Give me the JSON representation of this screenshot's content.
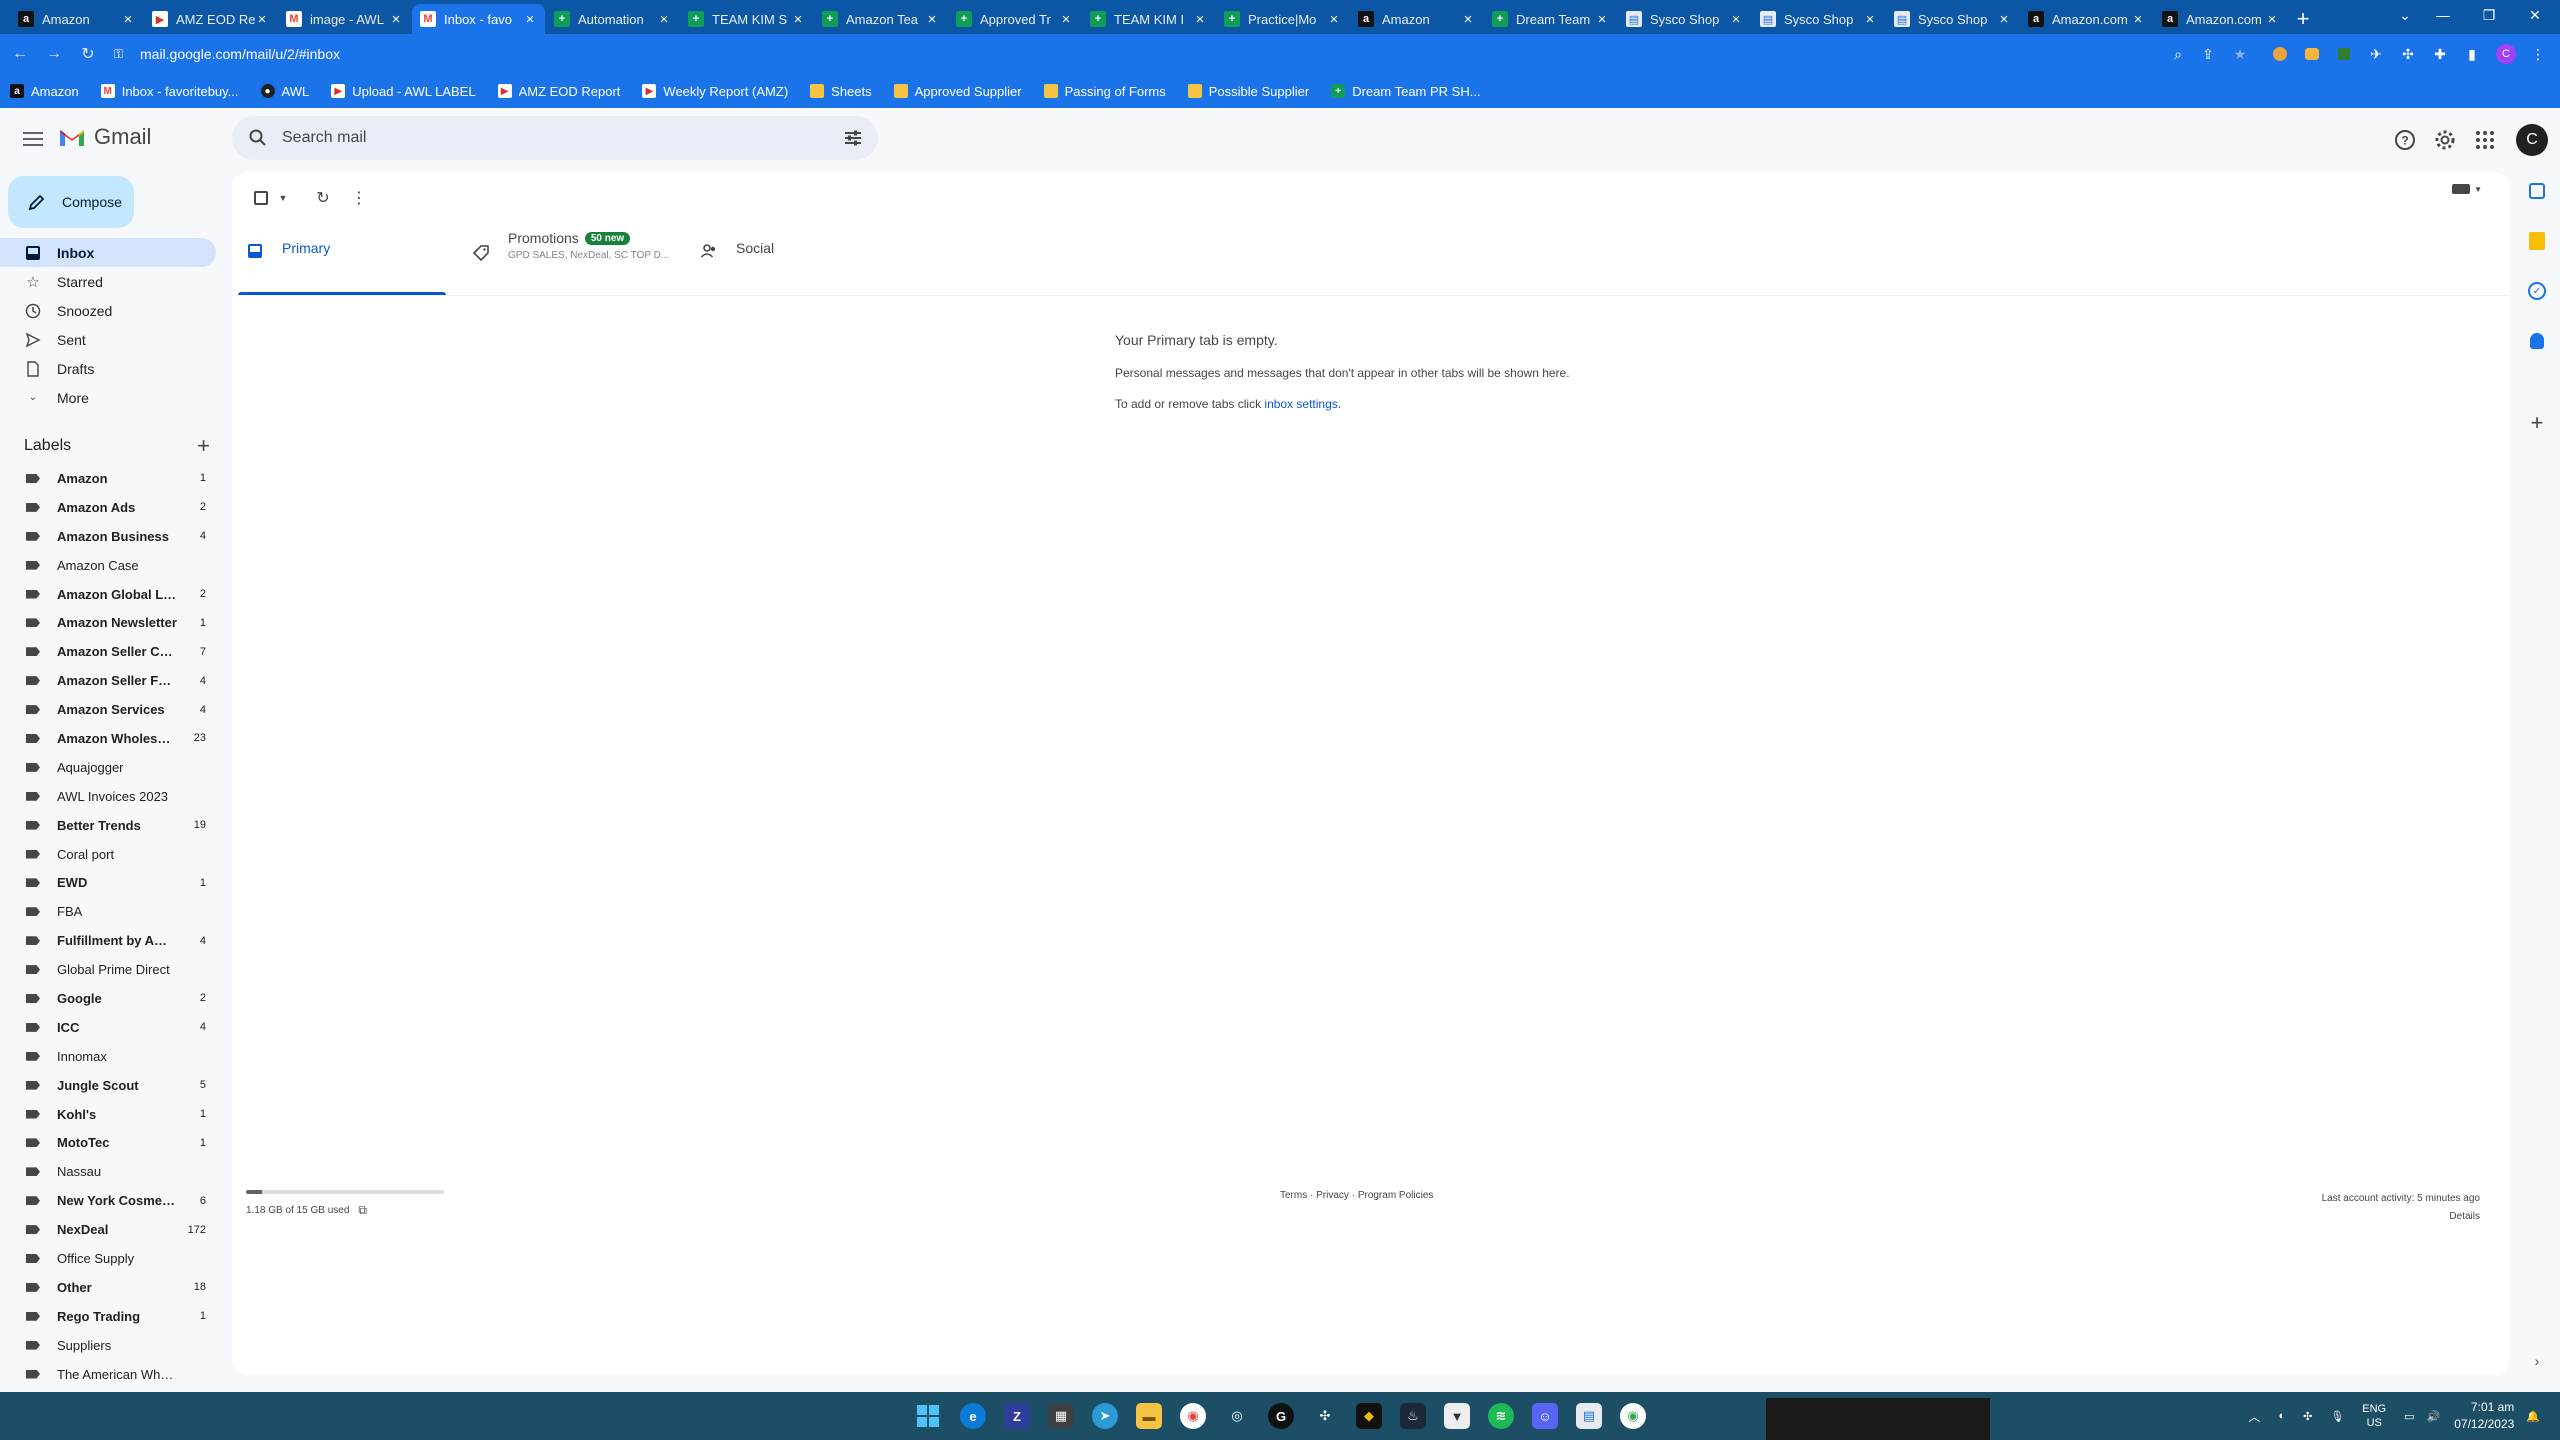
{
  "browser": {
    "tabs": [
      {
        "title": "Amazon",
        "icon": "amazon"
      },
      {
        "title": "AMZ EOD Re",
        "icon": "awl"
      },
      {
        "title": "image - AWL",
        "icon": "gmail"
      },
      {
        "title": "Inbox - favo",
        "icon": "gmail"
      },
      {
        "title": "Automation",
        "icon": "sheets"
      },
      {
        "title": "TEAM KIM S",
        "icon": "sheets"
      },
      {
        "title": "Amazon Tea",
        "icon": "sheets"
      },
      {
        "title": "Approved Tr",
        "icon": "sheets"
      },
      {
        "title": "TEAM KIM I",
        "icon": "sheets"
      },
      {
        "title": "Practice|Mo",
        "icon": "sheets"
      },
      {
        "title": "Amazon",
        "icon": "amazon"
      },
      {
        "title": "Dream Team",
        "icon": "sheets"
      },
      {
        "title": "Sysco Shop",
        "icon": "sysco"
      },
      {
        "title": "Sysco Shop",
        "icon": "sysco"
      },
      {
        "title": "Sysco Shop",
        "icon": "sysco"
      },
      {
        "title": "Amazon.com",
        "icon": "amazon"
      },
      {
        "title": "Amazon.com",
        "icon": "amazon"
      }
    ],
    "active_tab": 3,
    "url": "mail.google.com/mail/u/2/#inbox",
    "profile_initial": "C",
    "bookmarks": [
      {
        "label": "Amazon",
        "icon": "amazon"
      },
      {
        "label": "Inbox - favoritebuy...",
        "icon": "gmail"
      },
      {
        "label": "AWL",
        "icon": "dark"
      },
      {
        "label": "Upload - AWL LABEL",
        "icon": "awl"
      },
      {
        "label": "AMZ EOD Report",
        "icon": "awl"
      },
      {
        "label": "Weekly Report (AMZ)",
        "icon": "awl"
      },
      {
        "label": "Sheets",
        "icon": "folder"
      },
      {
        "label": "Approved Supplier",
        "icon": "folder"
      },
      {
        "label": "Passing of Forms",
        "icon": "folder"
      },
      {
        "label": "Possible Supplier",
        "icon": "folder"
      },
      {
        "label": "Dream Team PR SH...",
        "icon": "sheets"
      }
    ]
  },
  "gmail": {
    "brand": "Gmail",
    "search_placeholder": "Search mail",
    "avatar_initial": "C",
    "compose_label": "Compose",
    "nav": [
      {
        "label": "Inbox",
        "icon": "inbox-icon",
        "active": true
      },
      {
        "label": "Starred",
        "icon": "star-icon"
      },
      {
        "label": "Snoozed",
        "icon": "clock-icon"
      },
      {
        "label": "Sent",
        "icon": "send-icon"
      },
      {
        "label": "Drafts",
        "icon": "draft-icon"
      },
      {
        "label": "More",
        "icon": "chevron-down-icon"
      }
    ],
    "labels_title": "Labels",
    "labels": [
      {
        "name": "Amazon",
        "count": "1",
        "bold": true
      },
      {
        "name": "Amazon Ads",
        "count": "2",
        "bold": true
      },
      {
        "name": "Amazon Business",
        "count": "4",
        "bold": true
      },
      {
        "name": "Amazon Case",
        "count": "",
        "bold": false
      },
      {
        "name": "Amazon Global Lo...",
        "count": "2",
        "bold": true
      },
      {
        "name": "Amazon Newsletter",
        "count": "1",
        "bold": true
      },
      {
        "name": "Amazon Seller Cen...",
        "count": "7",
        "bold": true
      },
      {
        "name": "Amazon Seller For...",
        "count": "4",
        "bold": true
      },
      {
        "name": "Amazon Services",
        "count": "4",
        "bold": true
      },
      {
        "name": "Amazon Wholesal...",
        "count": "23",
        "bold": true
      },
      {
        "name": "Aquajogger",
        "count": "",
        "bold": false
      },
      {
        "name": "AWL Invoices 2023",
        "count": "",
        "bold": false
      },
      {
        "name": "Better Trends",
        "count": "19",
        "bold": true
      },
      {
        "name": "Coral port",
        "count": "",
        "bold": false
      },
      {
        "name": "EWD",
        "count": "1",
        "bold": true
      },
      {
        "name": "FBA",
        "count": "",
        "bold": false
      },
      {
        "name": "Fulfillment by Ama...",
        "count": "4",
        "bold": true
      },
      {
        "name": "Global Prime Direct",
        "count": "",
        "bold": false
      },
      {
        "name": "Google",
        "count": "2",
        "bold": true
      },
      {
        "name": "ICC",
        "count": "4",
        "bold": true
      },
      {
        "name": "Innomax",
        "count": "",
        "bold": false
      },
      {
        "name": "Jungle Scout",
        "count": "5",
        "bold": true
      },
      {
        "name": "Kohl's",
        "count": "1",
        "bold": true
      },
      {
        "name": "MotoTec",
        "count": "1",
        "bold": true
      },
      {
        "name": "Nassau",
        "count": "",
        "bold": false
      },
      {
        "name": "New York Cosmetix",
        "count": "6",
        "bold": true
      },
      {
        "name": "NexDeal",
        "count": "172",
        "bold": true
      },
      {
        "name": "Office Supply",
        "count": "",
        "bold": false
      },
      {
        "name": "Other",
        "count": "18",
        "bold": true
      },
      {
        "name": "Rego Trading",
        "count": "1",
        "bold": true
      },
      {
        "name": "Suppliers",
        "count": "",
        "bold": false
      },
      {
        "name": "The American Wholesal...",
        "count": "",
        "bold": false
      }
    ],
    "inbox_tabs": {
      "primary": "Primary",
      "promotions": "Promotions",
      "promotions_badge": "50 new",
      "promotions_senders": "GPD SALES, NexDeal, SC TOP D...",
      "social": "Social"
    },
    "empty_state": {
      "title": "Your Primary tab is empty.",
      "line1": "Personal messages and messages that don't appear in other tabs will be shown here.",
      "line2_prefix": "To add or remove tabs click ",
      "line2_link": "inbox settings",
      "line2_suffix": "."
    },
    "storage": {
      "text": "1.18 GB of 15 GB used",
      "fraction": 0.079
    },
    "footer": {
      "terms": "Terms",
      "privacy": "Privacy",
      "policies": "Program Policies",
      "sep": " · "
    },
    "activity": {
      "text": "Last account activity: 5 minutes ago",
      "details": "Details"
    }
  },
  "taskbar": {
    "lang": "ENG",
    "region": "US",
    "time": "7:01 am",
    "date": "07/12/2023"
  }
}
